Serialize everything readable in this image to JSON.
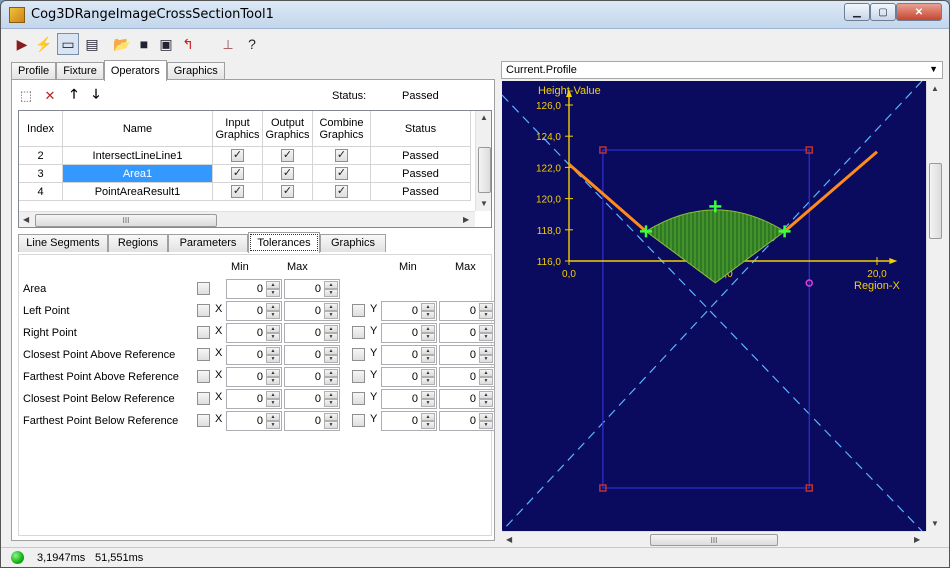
{
  "window": {
    "title": "Cog3DRangeImageCrossSectionTool1"
  },
  "toolbar": {
    "buttons": [
      {
        "icon": "run-icon",
        "glyph": "▶",
        "color": "#8b1a1a"
      },
      {
        "icon": "electric-icon",
        "glyph": "⚡",
        "color": "#d8b400"
      },
      {
        "icon": "show-edit-icon",
        "glyph": "▭",
        "color": "#223"
      },
      {
        "icon": "properties-icon",
        "glyph": "▤",
        "color": "#223"
      },
      {
        "icon": "open-icon",
        "glyph": "📂",
        "color": "#c48a1a"
      },
      {
        "icon": "save-icon",
        "glyph": "■",
        "color": "#223"
      },
      {
        "icon": "save-as-icon",
        "glyph": "▣",
        "color": "#223"
      },
      {
        "icon": "reset-icon",
        "glyph": "↰",
        "color": "#c22"
      },
      {
        "icon": "tool-options-icon",
        "glyph": "⟂",
        "color": "#a66"
      },
      {
        "icon": "help-icon",
        "glyph": "?",
        "color": "#222"
      }
    ]
  },
  "main_tabs": [
    "Profile",
    "Fixture",
    "Operators",
    "Graphics"
  ],
  "main_tabs_active": 2,
  "operators": {
    "status_label": "Status:",
    "status_value": "Passed",
    "columns": [
      "Index",
      "Name",
      "Input Graphics",
      "Output Graphics",
      "Combine Graphics",
      "Status"
    ],
    "rows": [
      {
        "index": "2",
        "name": "IntersectLineLine1",
        "input": true,
        "output": true,
        "combine": true,
        "status": "Passed"
      },
      {
        "index": "3",
        "name": "Area1",
        "input": true,
        "output": true,
        "combine": true,
        "status": "Passed",
        "selected": true
      },
      {
        "index": "4",
        "name": "PointAreaResult1",
        "input": true,
        "output": true,
        "combine": true,
        "status": "Passed"
      }
    ],
    "hscroll_glyph": "III"
  },
  "sub_tabs": [
    "Line Segments",
    "Regions",
    "Parameters",
    "Tolerances",
    "Graphics"
  ],
  "sub_tabs_active": 3,
  "tolerances": {
    "col_min": "Min",
    "col_max": "Max",
    "rows": [
      {
        "label": "Area",
        "x_min": "0",
        "x_max": "0"
      },
      {
        "label": "Left Point",
        "x_letter": "X",
        "x_min": "0",
        "x_max": "0",
        "y_letter": "Y",
        "y_min": "0",
        "y_max": "0"
      },
      {
        "label": "Right Point",
        "x_letter": "X",
        "x_min": "0",
        "x_max": "0",
        "y_letter": "Y",
        "y_min": "0",
        "y_max": "0"
      },
      {
        "label": "Closest Point Above Reference",
        "x_letter": "X",
        "x_min": "0",
        "x_max": "0",
        "y_letter": "Y",
        "y_min": "0",
        "y_max": "0"
      },
      {
        "label": "Farthest Point Above Reference",
        "x_letter": "X",
        "x_min": "0",
        "x_max": "0",
        "y_letter": "Y",
        "y_min": "0",
        "y_max": "0"
      },
      {
        "label": "Closest Point Below Reference",
        "x_letter": "X",
        "x_min": "0",
        "x_max": "0",
        "y_letter": "Y",
        "y_min": "0",
        "y_max": "0"
      },
      {
        "label": "Farthest Point Below Reference",
        "x_letter": "X",
        "x_min": "0",
        "x_max": "0",
        "y_letter": "Y",
        "y_min": "0",
        "y_max": "0"
      }
    ]
  },
  "display": {
    "selector_value": "Current.Profile",
    "hscroll_glyph": "III"
  },
  "chart_data": {
    "type": "line",
    "ylabel": "Height-Value",
    "xlabel": "Region-X",
    "x_ticks": [
      "0,0",
      "10,0",
      "20,0"
    ],
    "y_ticks": [
      "116,0",
      "118,0",
      "120,0",
      "122,0",
      "124,0",
      "126,0"
    ],
    "xlim": [
      0,
      22
    ],
    "ylim": [
      115.5,
      126.5
    ],
    "series": [
      {
        "values_x": [
          0,
          5.0
        ],
        "values_y": [
          122.2,
          117.9
        ]
      },
      {
        "values_x": [
          14.0,
          20.0
        ],
        "values_y": [
          117.9,
          123.0
        ]
      }
    ],
    "colors": {
      "background": "#0a0a5e",
      "profile": "#ff8c1a",
      "fill": "#2e7a22",
      "marker": "#3cff3c",
      "axis": "#f4d000",
      "guide": "#5ab4ff",
      "region": "#3030d0",
      "handle": "#c03030"
    }
  },
  "status_bar": {
    "time1": "3,1947ms",
    "time2": "51,551ms",
    "led_color": "#12b112"
  }
}
